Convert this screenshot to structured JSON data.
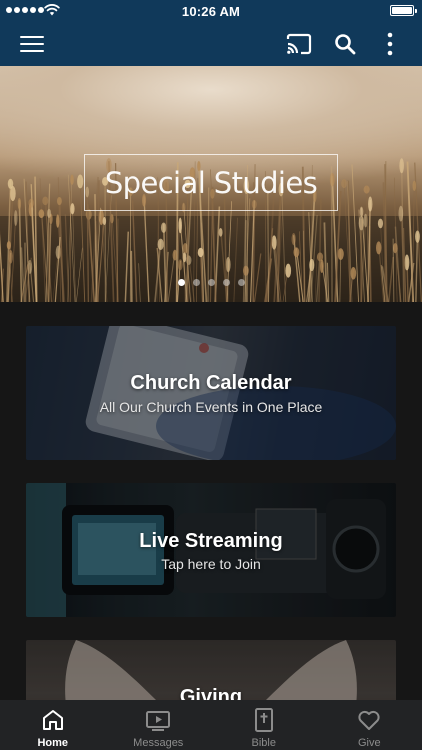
{
  "status_bar": {
    "time": "10:26 AM",
    "signal_icon": "signal-dots-icon",
    "wifi_icon": "wifi-icon",
    "battery_icon": "battery-icon",
    "battery_level": 1.0
  },
  "app_bar": {
    "menu_icon": "hamburger-menu-icon",
    "cast_icon": "cast-icon",
    "search_icon": "search-icon",
    "more_icon": "more-vertical-icon",
    "color": "#10395a"
  },
  "hero": {
    "title": "Special Studies",
    "slide_count": 5,
    "active_slide": 1
  },
  "cards": {
    "calendar": {
      "title": "Church Calendar",
      "subtitle": "All Our Church Events in One Place"
    },
    "streaming": {
      "title": "Live Streaming",
      "subtitle": "Tap here to Join"
    },
    "giving": {
      "title": "Giving"
    }
  },
  "tab_bar": {
    "tabs": [
      {
        "label": "Home",
        "icon": "home-icon",
        "active": true
      },
      {
        "label": "Messages",
        "icon": "video-player-icon",
        "active": false
      },
      {
        "label": "Bible",
        "icon": "bible-icon",
        "active": false
      },
      {
        "label": "Give",
        "icon": "heart-icon",
        "active": false
      }
    ]
  }
}
